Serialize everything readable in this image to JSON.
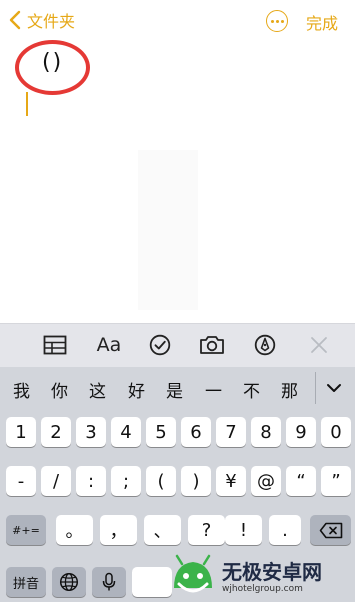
{
  "nav": {
    "back_label": "文件夹",
    "done_label": "完成"
  },
  "note": {
    "text": "()"
  },
  "candidates": [
    "我",
    "你",
    "这",
    "好",
    "是",
    "一",
    "不",
    "那"
  ],
  "keyboard": {
    "row1": [
      "1",
      "2",
      "3",
      "4",
      "5",
      "6",
      "7",
      "8",
      "9",
      "0"
    ],
    "row2": [
      "-",
      "/",
      ":",
      ";",
      "(",
      ")",
      "¥",
      "@",
      "“",
      "”"
    ],
    "row3_mode": "#+=",
    "row3": [
      "。",
      "，",
      "、",
      "?",
      "!",
      "."
    ],
    "row4_pinyin": "拼音"
  },
  "toolbar": {
    "format_label": "Aa"
  },
  "watermark": {
    "title": "无极安卓网",
    "url": "wjhotelgroup.com"
  },
  "colors": {
    "accent": "#e6a817",
    "annotation": "#e53935",
    "keyboard_bg": "#d2d5db"
  }
}
